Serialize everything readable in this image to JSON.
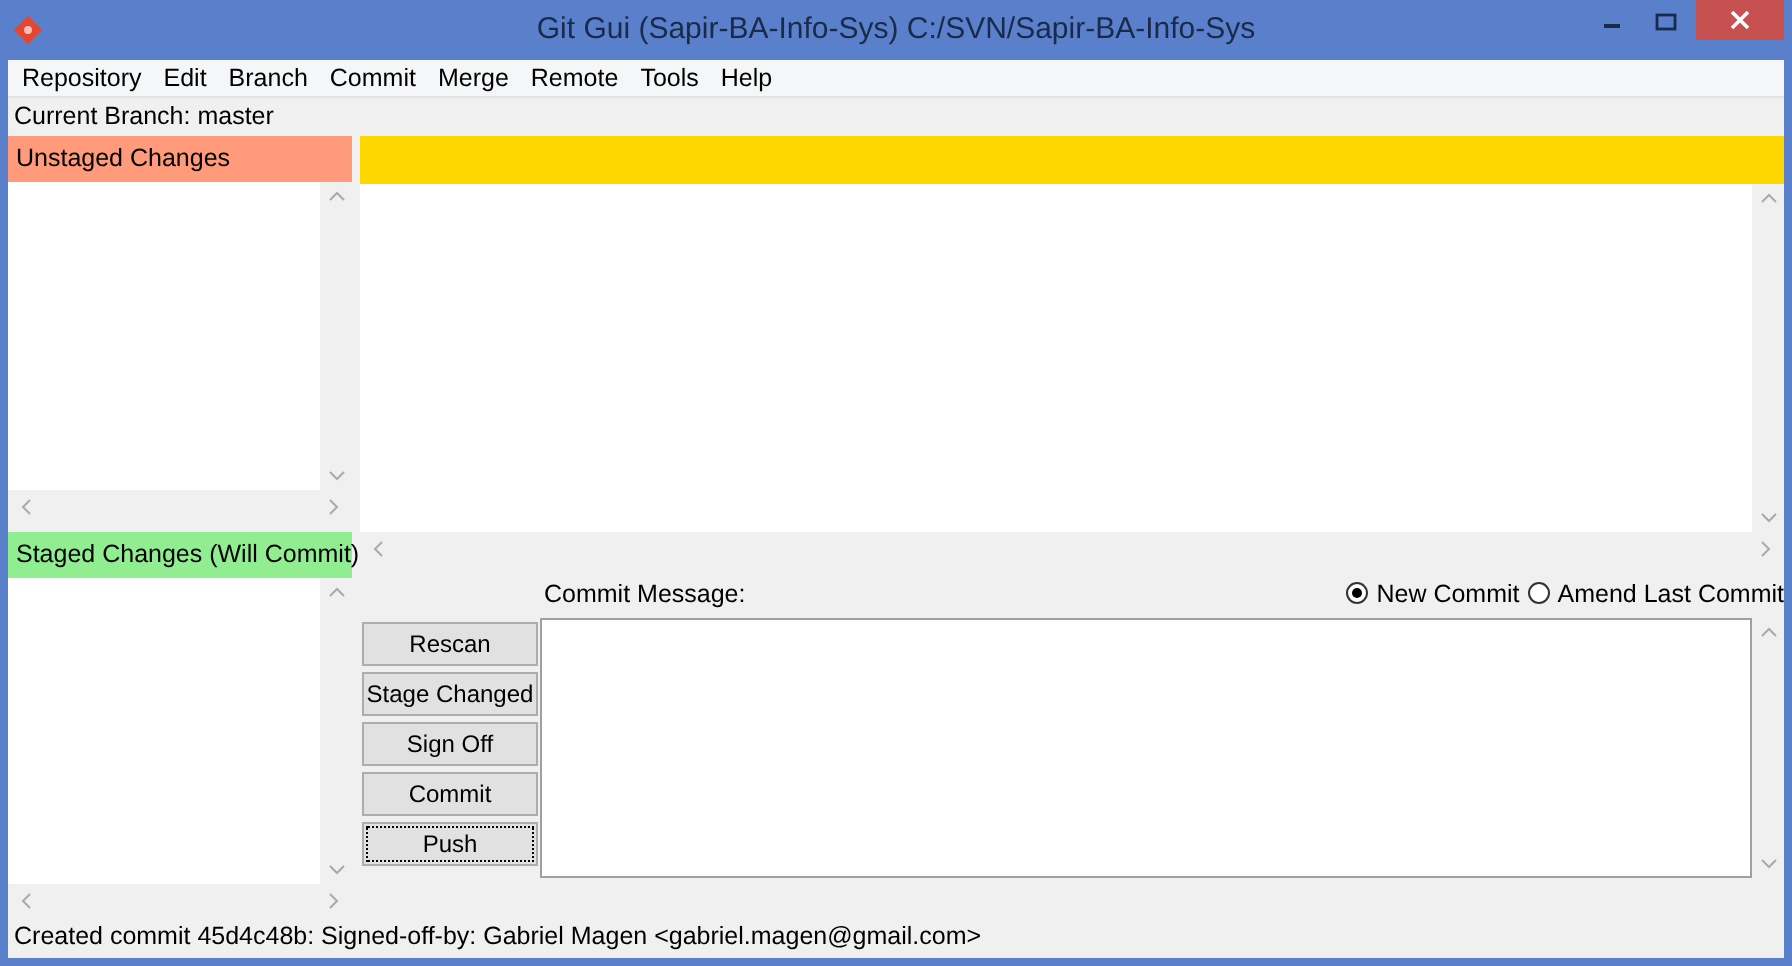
{
  "window": {
    "title": "Git Gui (Sapir-BA-Info-Sys) C:/SVN/Sapir-BA-Info-Sys"
  },
  "menu": [
    "Repository",
    "Edit",
    "Branch",
    "Commit",
    "Merge",
    "Remote",
    "Tools",
    "Help"
  ],
  "current_branch": "Current Branch: master",
  "unstaged": {
    "title": "Unstaged Changes"
  },
  "staged": {
    "title": "Staged Changes (Will Commit)"
  },
  "commit_message_label": "Commit Message:",
  "commit_modes": [
    {
      "label": "New Commit",
      "selected": true
    },
    {
      "label": "Amend Last Commit",
      "selected": false
    }
  ],
  "buttons": [
    {
      "label": "Rescan",
      "focused": false
    },
    {
      "label": "Stage Changed",
      "focused": false
    },
    {
      "label": "Sign Off",
      "focused": false
    },
    {
      "label": "Commit",
      "focused": false
    },
    {
      "label": "Push",
      "focused": true
    }
  ],
  "status_bar": "Created commit 45d4c48b: Signed-off-by: Gabriel Magen <gabriel.magen@gmail.com>"
}
